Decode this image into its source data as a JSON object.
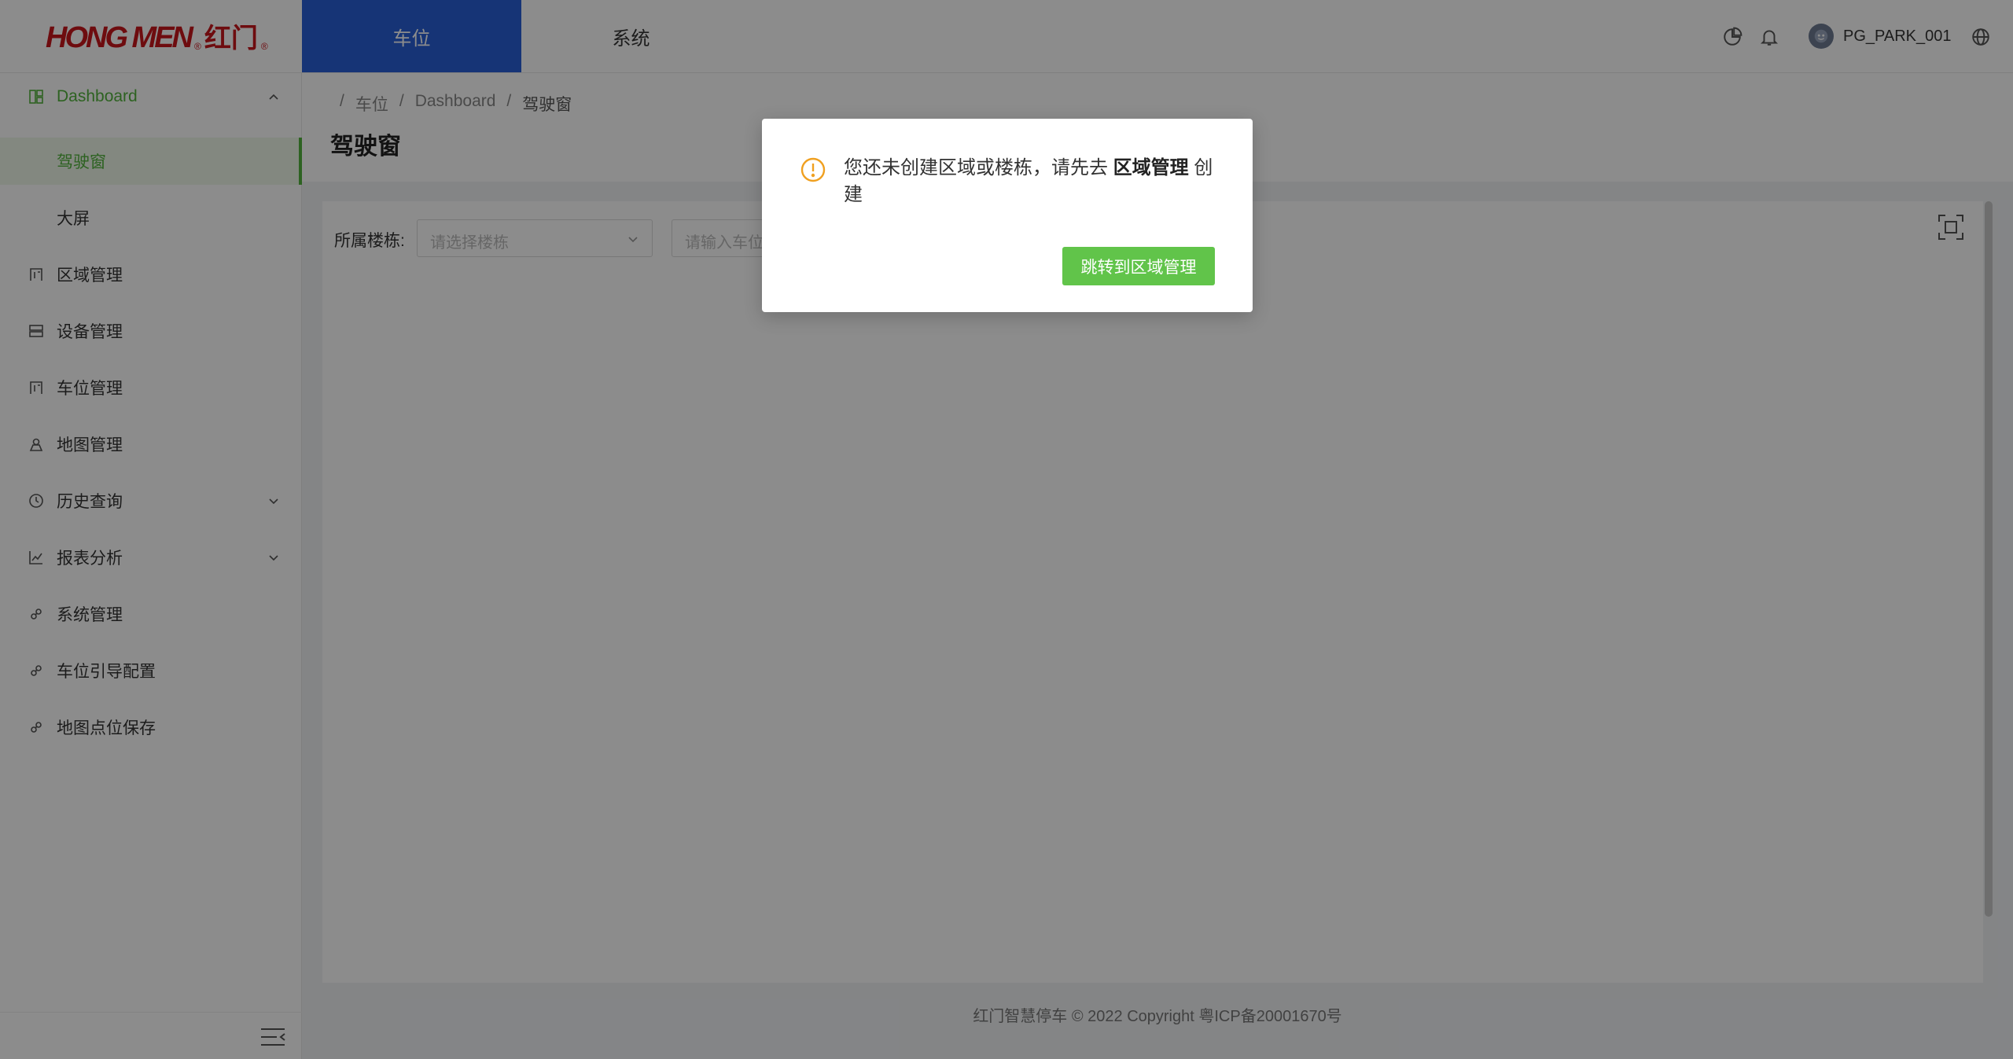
{
  "header": {
    "brand_latin": "HONG MEN",
    "brand_cn": "红门",
    "reg_mark": "®",
    "tabs": [
      {
        "label": "车位",
        "active": true
      },
      {
        "label": "系统",
        "active": false
      }
    ],
    "username": "PG_PARK_001",
    "accent_color": "#2860d8"
  },
  "sidebar": {
    "accent_color": "#52b33c",
    "items": [
      {
        "label": "Dashboard",
        "icon": "dashboard-icon",
        "state": "open"
      },
      {
        "label": "驾驶窗",
        "state": "selected"
      },
      {
        "label": "大屏"
      },
      {
        "label": "区域管理",
        "icon": "building-icon"
      },
      {
        "label": "设备管理",
        "icon": "device-icon"
      },
      {
        "label": "车位管理",
        "icon": "building-icon"
      },
      {
        "label": "地图管理",
        "icon": "map-icon"
      },
      {
        "label": "历史查询",
        "icon": "clock-icon",
        "expandable": true
      },
      {
        "label": "报表分析",
        "icon": "chart-line-icon",
        "expandable": true
      },
      {
        "label": "系统管理",
        "icon": "link-icon"
      },
      {
        "label": "车位引导配置",
        "icon": "link-icon"
      },
      {
        "label": "地图点位保存",
        "icon": "link-icon"
      }
    ]
  },
  "breadcrumb": [
    "车位",
    "Dashboard",
    "驾驶窗"
  ],
  "page_title": "驾驶窗",
  "filters": {
    "building_label": "所属楼栋:",
    "building_placeholder": "请选择楼栋",
    "space_placeholder": "请输入车位"
  },
  "footer": "红门智慧停车 © 2022 Copyright 粤ICP备20001670号",
  "modal": {
    "message_prefix": "您还未创建区域或楼栋，请先去",
    "message_bold": "区域管理",
    "message_suffix": "创建",
    "button_label": "跳转到区域管理",
    "warn_color": "#f0a020",
    "button_color": "#61c44a"
  }
}
